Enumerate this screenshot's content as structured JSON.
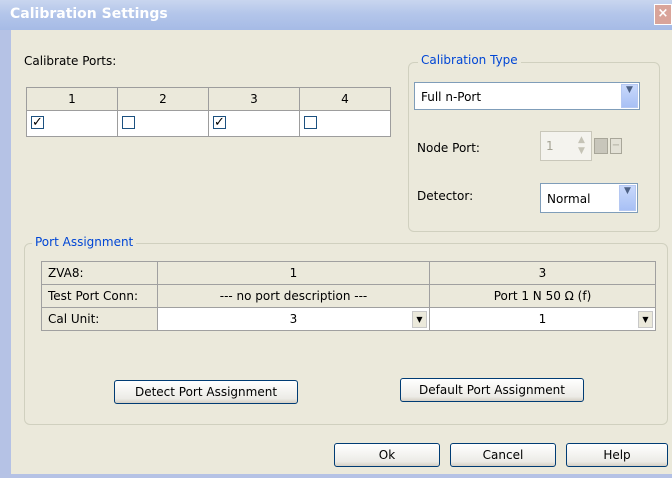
{
  "window": {
    "title": "Calibration Settings",
    "close_glyph": "×"
  },
  "calibrate_ports": {
    "label": "Calibrate Ports:",
    "ports": [
      {
        "number": "1",
        "checked": true
      },
      {
        "number": "2",
        "checked": false
      },
      {
        "number": "3",
        "checked": true
      },
      {
        "number": "4",
        "checked": false
      }
    ]
  },
  "calibration_type": {
    "group_title": "Calibration Type",
    "type_value": "Full n-Port",
    "node_port_label": "Node Port:",
    "node_port_value": "1",
    "detector_label": "Detector:",
    "detector_value": "Normal"
  },
  "port_assignment": {
    "group_title": "Port Assignment",
    "rows": [
      {
        "header": "ZVA8:",
        "col1": "1",
        "col2": "3"
      },
      {
        "header": "Test Port Conn:",
        "col1": "--- no port description ---",
        "col2": "Port 1   N 50 Ω (f)"
      },
      {
        "header": "Cal Unit:",
        "col1": "3",
        "col2": "1"
      }
    ],
    "detect_button": "Detect Port Assignment",
    "default_button": "Default Port Assignment"
  },
  "footer": {
    "ok": "Ok",
    "cancel": "Cancel",
    "help": "Help"
  },
  "colors": {
    "group_title": "#0046d5",
    "dialog_bg": "#ebe9db"
  }
}
